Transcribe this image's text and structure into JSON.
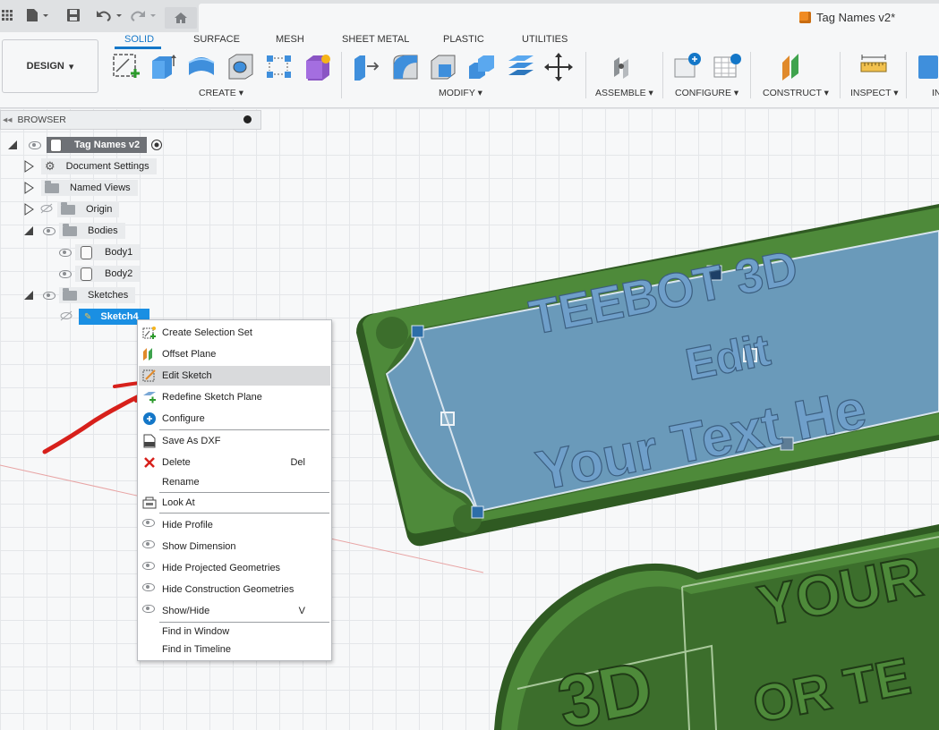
{
  "document": {
    "title": "Tag Names v2*"
  },
  "workspace": {
    "label": "DESIGN"
  },
  "tabs": [
    "SOLID",
    "SURFACE",
    "MESH",
    "SHEET METAL",
    "PLASTIC",
    "UTILITIES"
  ],
  "groups": {
    "create": "CREATE",
    "modify": "MODIFY",
    "assemble": "ASSEMBLE",
    "configure": "CONFIGURE",
    "construct": "CONSTRUCT",
    "inspect": "INSPECT",
    "insert_partial": "IN"
  },
  "browser": {
    "header": "BROWSER",
    "root": "Tag Names v2",
    "items": {
      "document_settings": "Document Settings",
      "named_views": "Named Views",
      "origin": "Origin",
      "bodies": "Bodies",
      "body1": "Body1",
      "body2": "Body2",
      "sketches": "Sketches",
      "sketch4": "Sketch4"
    }
  },
  "context_menu": {
    "items": [
      {
        "label": "Create Selection Set"
      },
      {
        "label": "Offset Plane"
      },
      {
        "label": "Edit Sketch"
      },
      {
        "label": "Redefine Sketch Plane"
      },
      {
        "label": "Configure"
      },
      {
        "label": "Save As DXF"
      },
      {
        "label": "Delete",
        "shortcut": "Del"
      },
      {
        "label": "Rename"
      },
      {
        "label": "Look At"
      },
      {
        "label": "Hide Profile"
      },
      {
        "label": "Show Dimension"
      },
      {
        "label": "Hide Projected Geometries"
      },
      {
        "label": "Hide Construction Geometries"
      },
      {
        "label": "Show/Hide",
        "shortcut": "V"
      },
      {
        "label": "Find in Window"
      },
      {
        "label": "Find in Timeline"
      }
    ]
  },
  "model_text": {
    "tag1_line1": "TEEBOT 3D",
    "tag1_line2": "Edit",
    "tag1_line3": "Your Text He",
    "tag2_line1": "YOUR",
    "tag2_line2": "OR TE",
    "tag2_badge": "3D"
  },
  "colors": {
    "accent": "#1477c8",
    "model_green": "#4e8a3a",
    "sketch_blue": "#6f9fca",
    "annotation_red": "#d7201b"
  }
}
